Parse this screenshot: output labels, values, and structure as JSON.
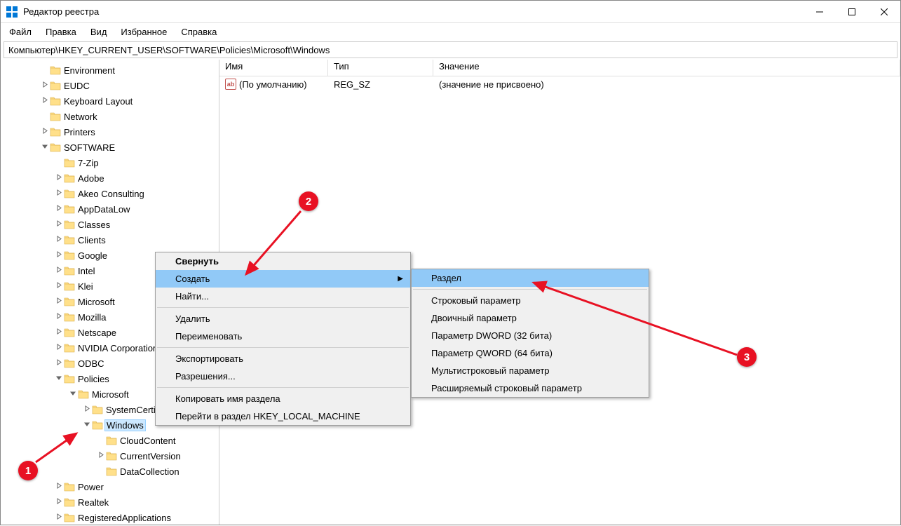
{
  "window": {
    "title": "Редактор реестра"
  },
  "menu": {
    "file": "Файл",
    "edit": "Правка",
    "view": "Вид",
    "favorites": "Избранное",
    "help": "Справка"
  },
  "address": "Компьютер\\HKEY_CURRENT_USER\\SOFTWARE\\Policies\\Microsoft\\Windows",
  "list": {
    "headers": {
      "name": "Имя",
      "type": "Тип",
      "value": "Значение"
    },
    "rows": [
      {
        "name": "(По умолчанию)",
        "type": "REG_SZ",
        "value": "(значение не присвоено)"
      }
    ]
  },
  "tree": {
    "items": [
      {
        "lvl": 2,
        "label": "Environment",
        "toggle": ""
      },
      {
        "lvl": 2,
        "label": "EUDC",
        "toggle": ">"
      },
      {
        "lvl": 2,
        "label": "Keyboard Layout",
        "toggle": ">"
      },
      {
        "lvl": 2,
        "label": "Network",
        "toggle": ""
      },
      {
        "lvl": 2,
        "label": "Printers",
        "toggle": ">"
      },
      {
        "lvl": 2,
        "label": "SOFTWARE",
        "toggle": "v"
      },
      {
        "lvl": 3,
        "label": "7-Zip",
        "toggle": ""
      },
      {
        "lvl": 3,
        "label": "Adobe",
        "toggle": ">"
      },
      {
        "lvl": 3,
        "label": "Akeo Consulting",
        "toggle": ">"
      },
      {
        "lvl": 3,
        "label": "AppDataLow",
        "toggle": ">"
      },
      {
        "lvl": 3,
        "label": "Classes",
        "toggle": ">"
      },
      {
        "lvl": 3,
        "label": "Clients",
        "toggle": ">"
      },
      {
        "lvl": 3,
        "label": "Google",
        "toggle": ">"
      },
      {
        "lvl": 3,
        "label": "Intel",
        "toggle": ">"
      },
      {
        "lvl": 3,
        "label": "Klei",
        "toggle": ">"
      },
      {
        "lvl": 3,
        "label": "Microsoft",
        "toggle": ">"
      },
      {
        "lvl": 3,
        "label": "Mozilla",
        "toggle": ">"
      },
      {
        "lvl": 3,
        "label": "Netscape",
        "toggle": ">"
      },
      {
        "lvl": 3,
        "label": "NVIDIA Corporation",
        "toggle": ">"
      },
      {
        "lvl": 3,
        "label": "ODBC",
        "toggle": ">"
      },
      {
        "lvl": 3,
        "label": "Policies",
        "toggle": "v"
      },
      {
        "lvl": 4,
        "label": "Microsoft",
        "toggle": "v"
      },
      {
        "lvl": 5,
        "label": "SystemCertificates",
        "toggle": ">"
      },
      {
        "lvl": 5,
        "label": "Windows",
        "toggle": "v",
        "selected": true
      },
      {
        "lvl": 6,
        "label": "CloudContent",
        "toggle": ""
      },
      {
        "lvl": 6,
        "label": "CurrentVersion",
        "toggle": ">"
      },
      {
        "lvl": 6,
        "label": "DataCollection",
        "toggle": ""
      },
      {
        "lvl": 3,
        "label": "Power",
        "toggle": ">"
      },
      {
        "lvl": 3,
        "label": "Realtek",
        "toggle": ">"
      },
      {
        "lvl": 3,
        "label": "RegisteredApplications",
        "toggle": ">"
      }
    ]
  },
  "context1": {
    "items": [
      {
        "label": "Свернуть",
        "bold": true
      },
      {
        "label": "Создать",
        "hl": true,
        "arrow": true
      },
      {
        "label": "Найти..."
      },
      {
        "sep": true
      },
      {
        "label": "Удалить"
      },
      {
        "label": "Переименовать"
      },
      {
        "sep": true
      },
      {
        "label": "Экспортировать"
      },
      {
        "label": "Разрешения..."
      },
      {
        "sep": true
      },
      {
        "label": "Копировать имя раздела"
      },
      {
        "label": "Перейти в раздел HKEY_LOCAL_MACHINE"
      }
    ]
  },
  "context2": {
    "items": [
      {
        "label": "Раздел",
        "hl": true
      },
      {
        "sep": true
      },
      {
        "label": "Строковый параметр"
      },
      {
        "label": "Двоичный параметр"
      },
      {
        "label": "Параметр DWORD (32 бита)"
      },
      {
        "label": "Параметр QWORD (64 бита)"
      },
      {
        "label": "Мультистроковый параметр"
      },
      {
        "label": "Расширяемый строковый параметр"
      }
    ]
  },
  "annotations": {
    "b1": "1",
    "b2": "2",
    "b3": "3"
  }
}
